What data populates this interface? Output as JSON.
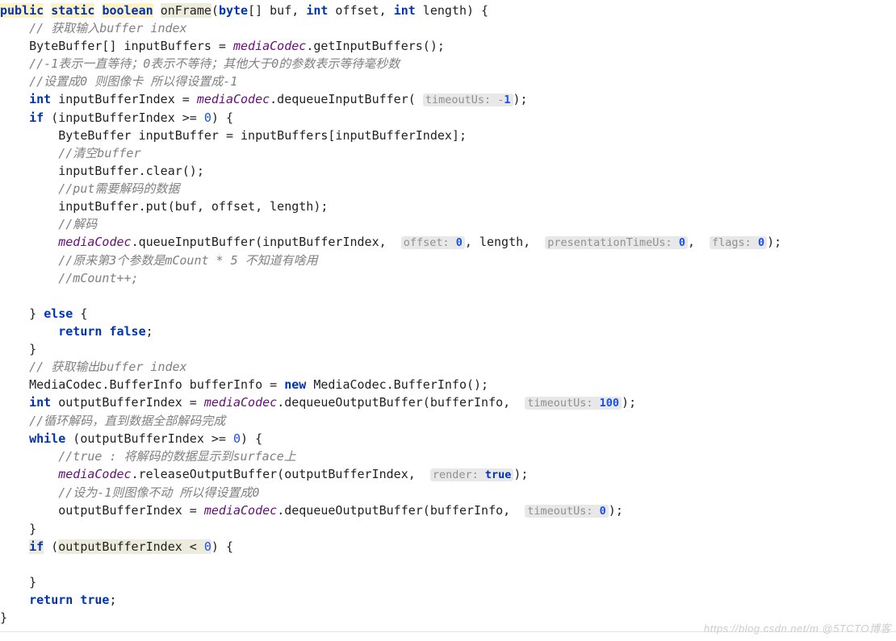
{
  "code": {
    "kw_public": "public",
    "kw_static": "static",
    "kw_boolean": "boolean",
    "method_name": "onFrame",
    "kw_byte": "byte",
    "param_buf": "[] buf, ",
    "kw_int1": "int",
    "param_offset": " offset, ",
    "kw_int2": "int",
    "param_length": " length) {",
    "c1": "// 获取输入buffer index",
    "l2a": "ByteBuffer[] inputBuffers = ",
    "field_mc": "mediaCodec",
    "l2b": ".getInputBuffers();",
    "c2": "//-1表示一直等待；0表示不等待；其他大于0的参数表示等待毫秒数",
    "c3": "//设置成0 则图像卡 所以得设置成-1",
    "kw_int3": "int",
    "l4a": " inputBufferIndex = ",
    "l4b": ".dequeueInputBuffer( ",
    "hint_to": "timeoutUs:",
    "l4c": "-",
    "num_1": "1",
    "l4d": ");",
    "kw_if": "if",
    "l5a": " (inputBufferIndex >= ",
    "num_0": "0",
    "l5b": ") {",
    "l6": "ByteBuffer inputBuffer = inputBuffers[inputBufferIndex];",
    "c4": "//清空buffer",
    "l7": "inputBuffer.clear();",
    "c5": "//put需要解码的数据",
    "l8": "inputBuffer.put(buf, offset, length);",
    "c6": "//解码",
    "l9a": ".queueInputBuffer(inputBufferIndex,  ",
    "hint_off": "offset:",
    "l9b": ", length,  ",
    "hint_pt": "presentationTimeUs:",
    "l9c": ",  ",
    "hint_fl": "flags:",
    "l9d": ");",
    "c7": "//原来第3个参数是mCount * 5 不知道有啥用",
    "c8": "//mCount++;",
    "l10a": "} ",
    "kw_else": "else",
    "l10b": " {",
    "kw_return": "return",
    "kw_false": "false",
    "l11": ";",
    "l12": "}",
    "c9": "// 获取输出buffer index",
    "l13a": "MediaCodec.BufferInfo bufferInfo = ",
    "kw_new": "new",
    "l13b": " MediaCodec.BufferInfo();",
    "kw_int4": "int",
    "l14a": " outputBufferIndex = ",
    "l14b": ".dequeueOutputBuffer(bufferInfo,  ",
    "num_100": "100",
    "l14c": ");",
    "c10": "//循环解码，直到数据全部解码完成",
    "kw_while": "while",
    "l15a": " (outputBufferIndex >= ",
    "l15b": ") {",
    "c11": "//true : 将解码的数据显示到surface上",
    "l16a": ".releaseOutputBuffer(outputBufferIndex,  ",
    "hint_ren": "render:",
    "kw_true": "true",
    "l16b": ");",
    "c12": "//设为-1则图像不动 所以得设置成0",
    "l17a": "outputBufferIndex = ",
    "l17b": ".dequeueOutputBuffer(bufferInfo,  ",
    "l17c": ");",
    "l18": "}",
    "kw_if2": "if",
    "l19a": " (",
    "l19b": "outputBufferIndex < ",
    "l19c": ") {",
    "l20": "}",
    "kw_return2": "return",
    "kw_true2": "true",
    "l21": ";",
    "l22": "}"
  },
  "watermark": "https://blog.csdn.net/m @5TCTO博客"
}
